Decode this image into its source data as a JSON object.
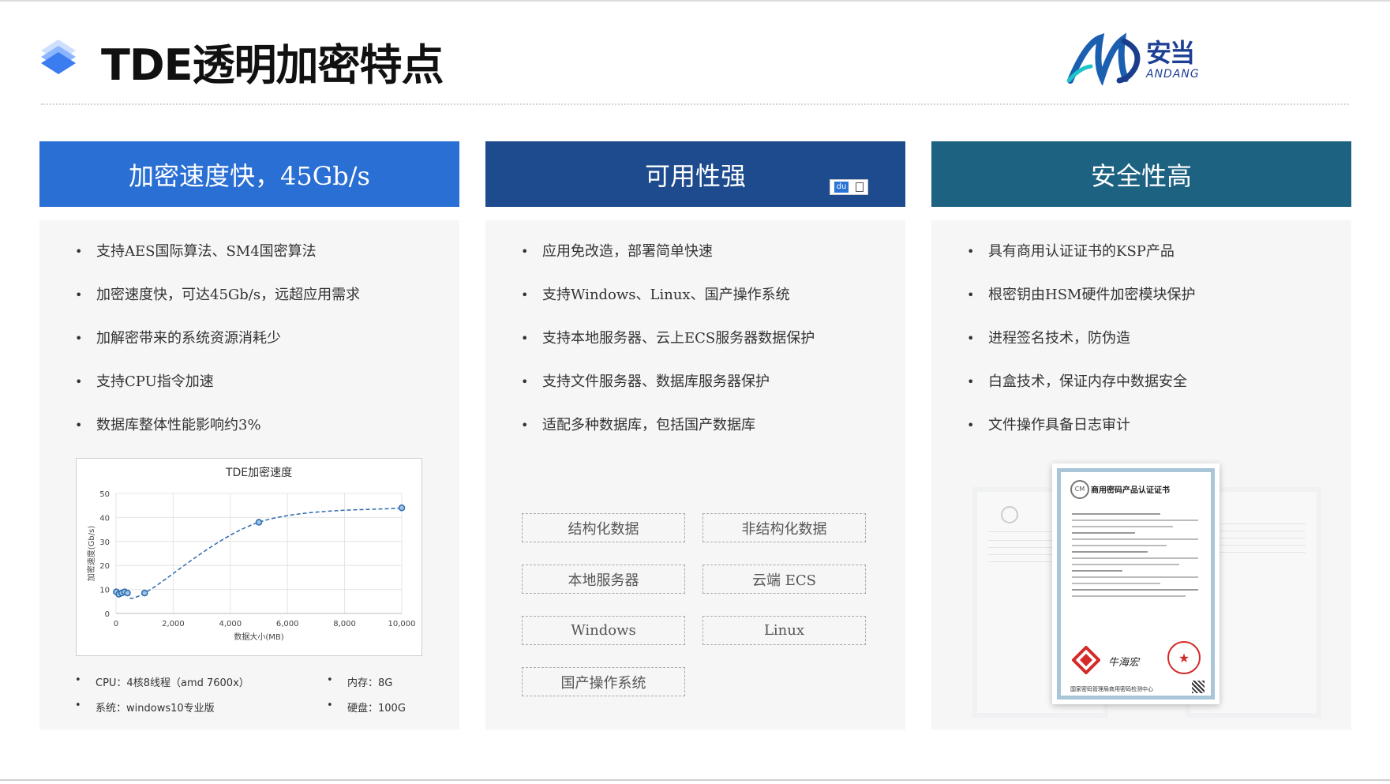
{
  "header": {
    "title": "TDE透明加密特点",
    "logo_cn": "安当",
    "logo_en": "ANDANG"
  },
  "colors": {
    "panel1": "#2a6fd4",
    "panel2": "#1d4b8e",
    "panel3": "#1e6282",
    "body_bg": "#f6f6f6",
    "series": "#2d6aad"
  },
  "panels": [
    {
      "title": "加密速度快，45Gb/s",
      "items": [
        "支持AES国际算法、SM4国密算法",
        "加密速度快，可达45Gb/s，远超应用需求",
        "加解密带来的系统资源消耗少",
        "支持CPU指令加速",
        "数据库整体性能影响约3%"
      ]
    },
    {
      "title": "可用性强",
      "items": [
        "应用免改造，部署简单快速",
        "支持Windows、Linux、国产操作系统",
        "支持本地服务器、云上ECS服务器数据保护",
        "支持文件服务器、数据库服务器保护",
        "适配多种数据库，包括国产数据库"
      ],
      "tags": [
        "结构化数据",
        "非结构化数据",
        "本地服务器",
        "云端 ECS",
        "Windows",
        "Linux",
        "国产操作系统"
      ],
      "widget_label": "du"
    },
    {
      "title": "安全性高",
      "items": [
        "具有商用认证证书的KSP产品",
        "根密钥由HSM硬件加密模块保护",
        "进程签名技术，防伪造",
        "白盒技术，保证内存中数据安全",
        "文件操作具备日志审计"
      ],
      "certificate": {
        "title": "商用密码产品认证证书",
        "signature": "牛海宏",
        "issuer": "国家密码管理局商用密码检测中心"
      }
    }
  ],
  "specs": {
    "cpu": "CPU：4核8线程（amd 7600x）",
    "memory": "内存：8G",
    "os": "系统：windows10专业版",
    "disk": "硬盘：100G"
  },
  "chart_data": {
    "type": "line",
    "title": "TDE加密速度",
    "xlabel": "数据大小(MB)",
    "ylabel": "加密速度(Gb/s)",
    "xlim": [
      0,
      10000
    ],
    "ylim": [
      0,
      50
    ],
    "x_ticks": [
      "0",
      "2,000",
      "4,000",
      "6,000",
      "8,000",
      "10,000"
    ],
    "y_ticks": [
      "0",
      "10",
      "20",
      "30",
      "40",
      "50"
    ],
    "grid": true,
    "smooth": true,
    "series": [
      {
        "x": [
          10,
          100,
          200,
          300,
          400,
          1000,
          5000,
          10000
        ],
        "y": [
          9,
          8,
          8.5,
          9,
          8.5,
          8.5,
          38,
          44
        ]
      }
    ]
  }
}
